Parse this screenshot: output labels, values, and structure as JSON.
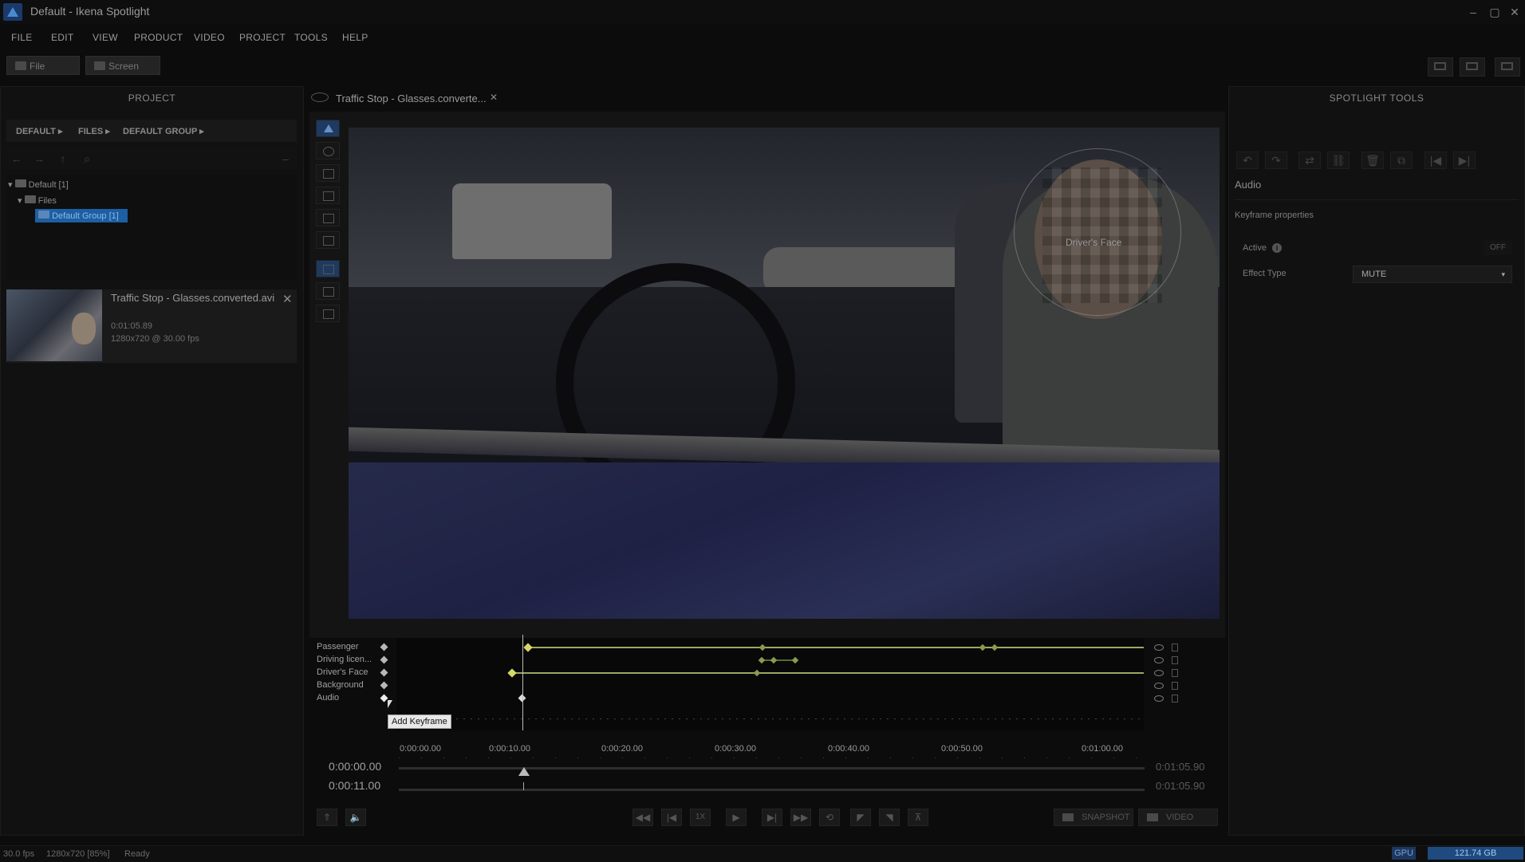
{
  "window": {
    "title": "Default - Ikena Spotlight",
    "minimize": "–",
    "maximize": "▢",
    "close": "✕"
  },
  "menu": [
    "FILE",
    "EDIT",
    "VIEW",
    "PRODUCT",
    "VIDEO",
    "PROJECT",
    "TOOLS",
    "HELP"
  ],
  "toolbar": {
    "file_label": "File",
    "screen_label": "Screen"
  },
  "project": {
    "title": "PROJECT",
    "breadcrumbs": [
      "DEFAULT ▸",
      "FILES ▸",
      "DEFAULT GROUP ▸"
    ],
    "tree": [
      {
        "label": "Default [1]"
      },
      {
        "label": "Files"
      },
      {
        "label": "Default Group [1]"
      }
    ],
    "file": {
      "name": "Traffic Stop - Glasses.converted.avi",
      "duration": "0:01:05.89",
      "resolution": "1280x720 @ 30.00 fps"
    }
  },
  "editor": {
    "tab_title": "Traffic Stop - Glasses.converte...",
    "face_label": "Driver's Face",
    "tracks": [
      {
        "label": "Passenger"
      },
      {
        "label": "Driving licen..."
      },
      {
        "label": "Driver's Face"
      },
      {
        "label": "Background"
      },
      {
        "label": "Audio"
      }
    ],
    "tooltip": "Add Keyframe",
    "ticks": [
      "0:00:00.00",
      "0:00:10.00",
      "0:00:20.00",
      "0:00:30.00",
      "0:00:40.00",
      "0:00:50.00",
      "0:01:00.00"
    ],
    "timecode_current": "0:00:00.00",
    "timecode_playhead": "0:00:11.00",
    "timecode_end_1": "0:01:05.90",
    "timecode_end_2": "0:01:05.90",
    "speed": "1X",
    "snapshot_label": "SNAPSHOT",
    "video_label": "VIDEO"
  },
  "tools_panel": {
    "title": "SPOTLIGHT TOOLS",
    "section": "Audio",
    "props_title": "Keyframe properties",
    "active_label": "Active",
    "active_value": "OFF",
    "effect_type_label": "Effect Type",
    "effect_type_value": "MUTE"
  },
  "status": {
    "fps": "30.0 fps",
    "res": "1280x720 [85%]",
    "state": "Ready",
    "gpu": "GPU",
    "disk": "121.74 GB"
  }
}
